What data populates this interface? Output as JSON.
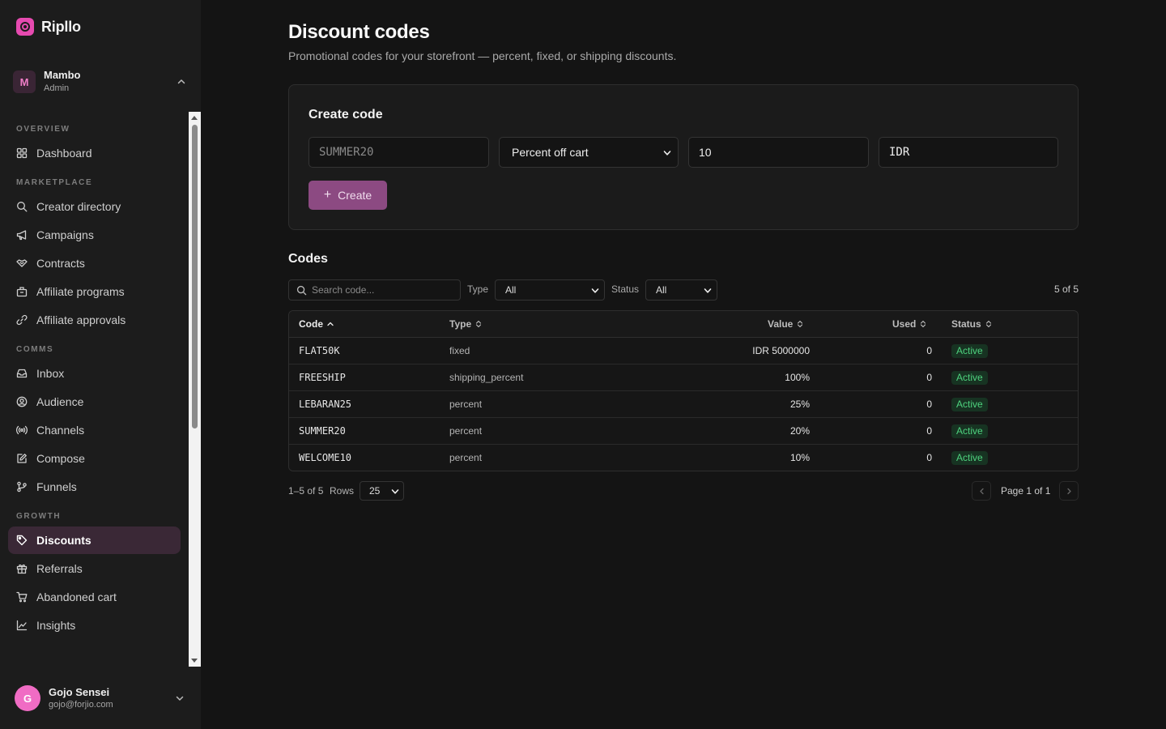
{
  "app": {
    "name": "Ripllo",
    "accent": "#e64ab0"
  },
  "workspace": {
    "initial": "M",
    "name": "Mambo",
    "role": "Admin"
  },
  "nav": {
    "sections": [
      {
        "label": "OVERVIEW",
        "items": [
          {
            "label": "Dashboard",
            "icon": "grid-icon"
          }
        ]
      },
      {
        "label": "MARKETPLACE",
        "items": [
          {
            "label": "Creator directory",
            "icon": "search-icon"
          },
          {
            "label": "Campaigns",
            "icon": "megaphone-icon"
          },
          {
            "label": "Contracts",
            "icon": "handshake-icon"
          },
          {
            "label": "Affiliate programs",
            "icon": "building-icon"
          },
          {
            "label": "Affiliate approvals",
            "icon": "link-icon"
          }
        ]
      },
      {
        "label": "COMMS",
        "items": [
          {
            "label": "Inbox",
            "icon": "inbox-icon"
          },
          {
            "label": "Audience",
            "icon": "user-circle-icon"
          },
          {
            "label": "Channels",
            "icon": "broadcast-icon"
          },
          {
            "label": "Compose",
            "icon": "edit-icon"
          },
          {
            "label": "Funnels",
            "icon": "git-branch-icon"
          }
        ]
      },
      {
        "label": "GROWTH",
        "items": [
          {
            "label": "Discounts",
            "icon": "tag-icon",
            "active": true
          },
          {
            "label": "Referrals",
            "icon": "gift-icon"
          },
          {
            "label": "Abandoned cart",
            "icon": "cart-icon"
          },
          {
            "label": "Insights",
            "icon": "chart-line-icon"
          }
        ]
      }
    ]
  },
  "user": {
    "initial": "G",
    "name": "Gojo Sensei",
    "email": "gojo@forjio.com"
  },
  "page": {
    "title": "Discount codes",
    "subtitle": "Promotional codes for your storefront — percent, fixed, or shipping discounts."
  },
  "create": {
    "title": "Create code",
    "code_placeholder": "SUMMER20",
    "type_selected": "Percent off cart",
    "value": "10",
    "currency": "IDR",
    "button_label": "Create"
  },
  "codes": {
    "title": "Codes",
    "search_placeholder": "Search code...",
    "type_label": "Type",
    "type_selected": "All",
    "status_label": "Status",
    "status_selected": "All",
    "count": "5 of 5",
    "columns": {
      "code": "Code",
      "type": "Type",
      "value": "Value",
      "used": "Used",
      "status": "Status"
    },
    "rows": [
      {
        "code": "FLAT50K",
        "type": "fixed",
        "value": "IDR 5000000",
        "used": "0",
        "status": "Active"
      },
      {
        "code": "FREESHIP",
        "type": "shipping_percent",
        "value": "100%",
        "used": "0",
        "status": "Active"
      },
      {
        "code": "LEBARAN25",
        "type": "percent",
        "value": "25%",
        "used": "0",
        "status": "Active"
      },
      {
        "code": "SUMMER20",
        "type": "percent",
        "value": "20%",
        "used": "0",
        "status": "Active"
      },
      {
        "code": "WELCOME10",
        "type": "percent",
        "value": "10%",
        "used": "0",
        "status": "Active"
      }
    ],
    "range": "1–5 of 5",
    "rows_label": "Rows",
    "rows_per_page": "25",
    "page_text": "Page 1 of 1",
    "status_color": "#4ed27e"
  }
}
